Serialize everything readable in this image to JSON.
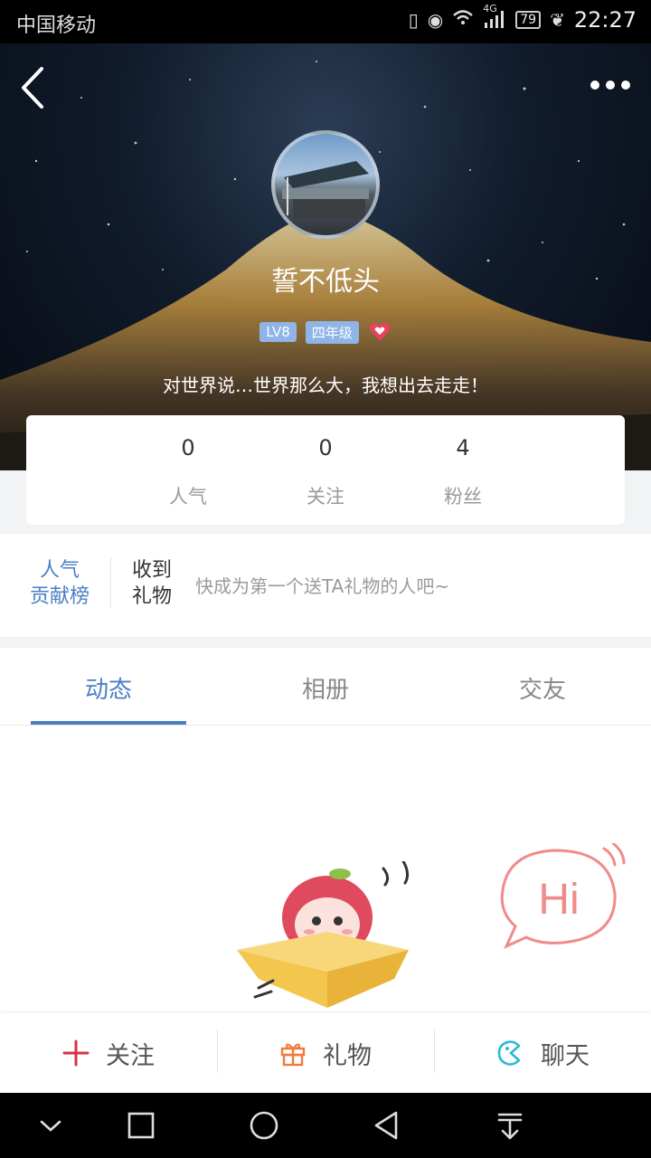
{
  "status_bar": {
    "carrier": "中国移动",
    "network": "4G",
    "battery": "79",
    "time": "22:27"
  },
  "profile": {
    "nickname": "誓不低头",
    "level_badge": "LV8",
    "grade_badge": "四年级",
    "bio": "对世界说…世界那么大，我想出去走走！"
  },
  "stats": [
    {
      "value": "0",
      "label": "人气"
    },
    {
      "value": "0",
      "label": "关注"
    },
    {
      "value": "4",
      "label": "粉丝"
    }
  ],
  "gifts": {
    "rank_line1": "人气",
    "rank_line2": "贡献榜",
    "received_line1": "收到",
    "received_line2": "礼物",
    "hint": "快成为第一个送TA礼物的人吧~"
  },
  "tabs": [
    {
      "label": "动态",
      "active": true
    },
    {
      "label": "相册",
      "active": false
    },
    {
      "label": "交友",
      "active": false
    }
  ],
  "hi_text": "Hi",
  "actions": [
    {
      "label": "关注",
      "icon": "plus-icon",
      "color": "#d8304a"
    },
    {
      "label": "礼物",
      "icon": "gift-icon",
      "color": "#f07a3c"
    },
    {
      "label": "聊天",
      "icon": "chat-icon",
      "color": "#2bb8d8"
    }
  ],
  "colors": {
    "accent": "#4a7fc6",
    "badge": "#8fb4e8",
    "heart": "#e8435a"
  }
}
